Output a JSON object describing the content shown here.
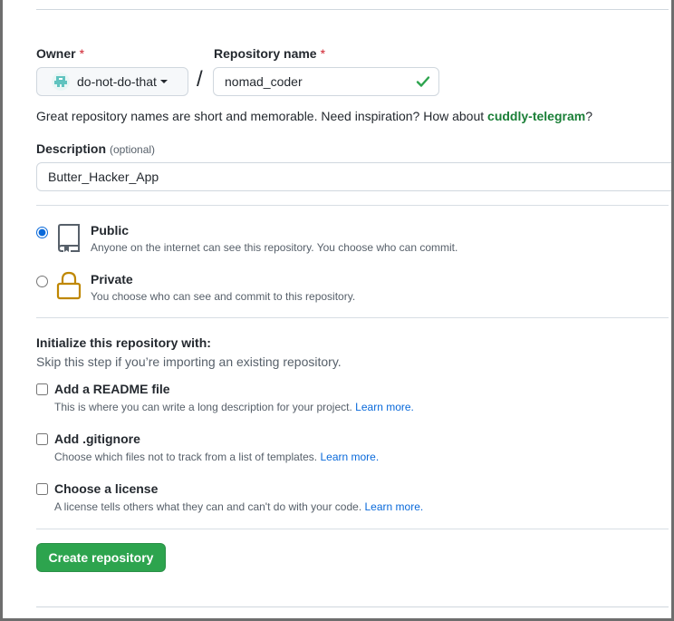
{
  "owner": {
    "label": "Owner",
    "required_mark": "*",
    "value": "do-not-do-that",
    "avatar_icon": "identicon-avatar"
  },
  "slash": "/",
  "repository": {
    "label": "Repository name",
    "required_mark": "*",
    "value": "nomad_coder",
    "valid_icon": "check-icon",
    "valid_color": "#1a7f37"
  },
  "hint": {
    "prefix": "Great repository names are short and memorable. Need inspiration? How about ",
    "suggestion": "cuddly-telegram",
    "suffix": "?"
  },
  "description": {
    "label": "Description",
    "optional": "(optional)",
    "value": "Butter_Hacker_App"
  },
  "visibility": {
    "selected": "public",
    "options": [
      {
        "id": "public",
        "title": "Public",
        "description": "Anyone on the internet can see this repository. You choose who can commit.",
        "icon": "repo-icon"
      },
      {
        "id": "private",
        "title": "Private",
        "description": "You choose who can see and commit to this repository.",
        "icon": "lock-icon"
      }
    ]
  },
  "init": {
    "title": "Initialize this repository with:",
    "subtitle": "Skip this step if you’re importing an existing repository.",
    "items": [
      {
        "title": "Add a README file",
        "description": "This is where you can write a long description for your project.",
        "link": "Learn more.",
        "checked": false
      },
      {
        "title": "Add .gitignore",
        "description": "Choose which files not to track from a list of templates.",
        "link": "Learn more.",
        "checked": false
      },
      {
        "title": "Choose a license",
        "description": "A license tells others what they can and can't do with your code.",
        "link": "Learn more.",
        "checked": false
      }
    ]
  },
  "submit": {
    "label": "Create repository",
    "color": "#2da44e"
  },
  "colors": {
    "accent": "#0969da",
    "success": "#1a7f37",
    "danger": "#cf222e",
    "private_icon": "#9a6700"
  }
}
